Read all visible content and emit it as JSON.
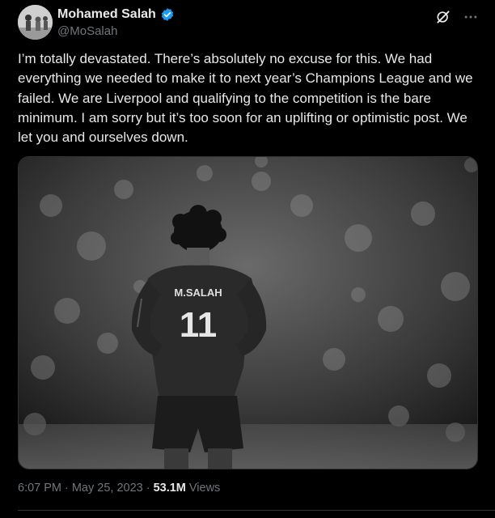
{
  "author": {
    "name": "Mohamed Salah",
    "handle": "@MoSalah",
    "verified_color": "#1d9bf0"
  },
  "actions": {
    "grok_icon": "grok-icon",
    "more_icon": "more-icon"
  },
  "tweet": {
    "text": "I’m totally devastated. There’s absolutely no excuse for this. We had everything we needed to make it to next year’s Champions League and we failed. We are Liverpool and qualifying to the competition is the bare minimum. I am sorry but it’s too soon for an uplifting or optimistic post. We let you and ourselves down.",
    "shirt_name": "M.SALAH",
    "shirt_number": "11"
  },
  "meta": {
    "time": "6:07 PM",
    "separator": "·",
    "date": "May 25, 2023",
    "separator2": "·",
    "views_count": "53.1M",
    "views_label": "Views"
  },
  "colors": {
    "background": "#000000",
    "text": "#e7e9ea",
    "secondary": "#71767b",
    "border": "#2f3336"
  }
}
